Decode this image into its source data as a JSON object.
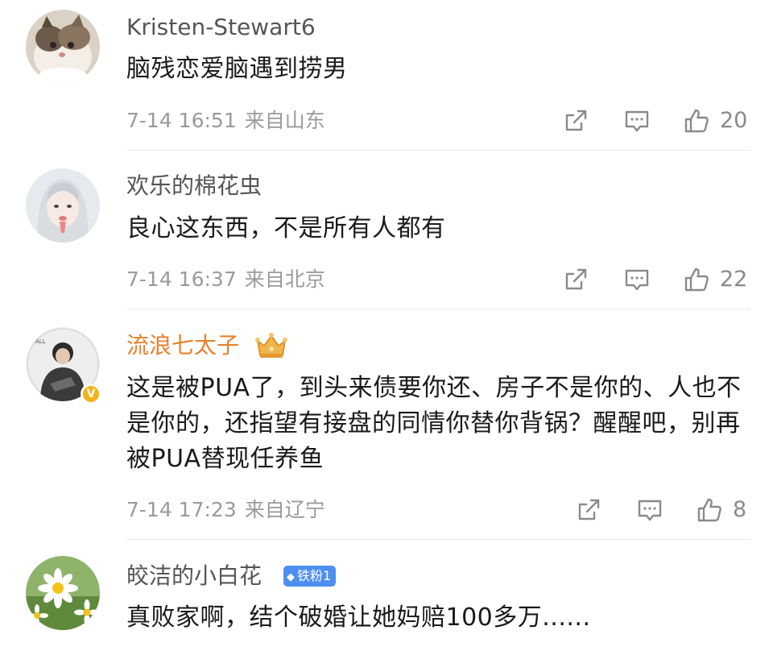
{
  "comments": [
    {
      "username": "Kristen-Stewart6",
      "text": "脑残恋爱脑遇到捞男",
      "time": "7-14 16:51",
      "location": "来自山东",
      "likes": "20",
      "avatar_icon": "cat-avatar"
    },
    {
      "username": "欢乐的棉花虫",
      "text": "良心这东西，不是所有人都有",
      "time": "7-14 16:37",
      "location": "来自北京",
      "likes": "22",
      "avatar_icon": "girl-avatar"
    },
    {
      "username": "流浪七太子",
      "text": "这是被PUA了，到头来债要你还、房子不是你的、人也不是你的，还指望有接盘的同情你替你背锅？醒醒吧，别再被PUA替现任养鱼",
      "time": "7-14 17:23",
      "location": "来自辽宁",
      "likes": "8",
      "verified_badge": "V",
      "avatar_icon": "person-avatar"
    },
    {
      "username": "皎洁的小白花",
      "badge": "铁粉1",
      "text": "真败家啊，结个破婚让她妈赔100多万......",
      "avatar_icon": "daisy-avatar"
    }
  ],
  "colors": {
    "username": "#555555",
    "vip_username": "#e8812c",
    "text": "#1a1a1a",
    "meta": "#9a9a9a",
    "fan_badge": "#4d8ff1",
    "verified": "#f6b21b"
  }
}
